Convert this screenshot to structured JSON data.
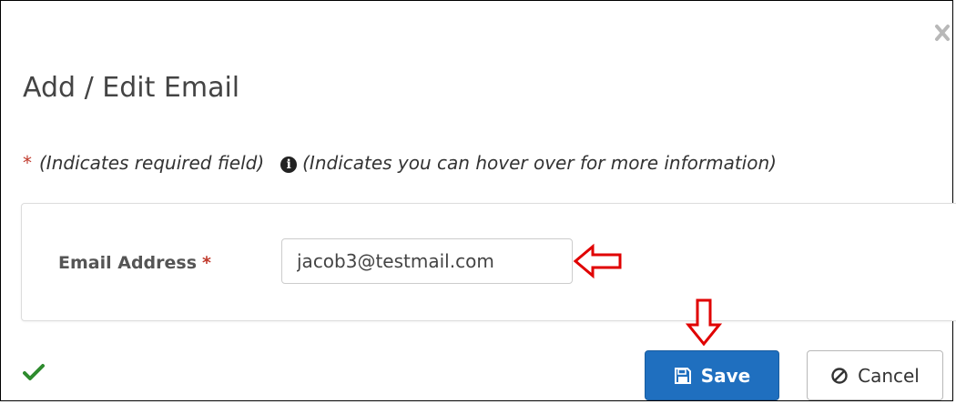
{
  "modal": {
    "title": "Add / Edit Email",
    "close_icon": "close-icon"
  },
  "legend": {
    "required_marker": "*",
    "required_text": "(Indicates required field)",
    "info_icon": "info-circle-icon",
    "info_text": "(Indicates you can hover over for more information)"
  },
  "form": {
    "email_label": "Email Address",
    "email_required_marker": "*",
    "email_value": "jacob3@testmail.com"
  },
  "footer": {
    "status_icon": "checkmark-icon",
    "save_label": "Save",
    "save_icon": "floppy-disk-icon",
    "cancel_label": "Cancel",
    "cancel_icon": "ban-icon"
  },
  "annotations": {
    "arrow_color": "#e00000"
  },
  "colors": {
    "primary": "#1f6fbf",
    "required": "#c0392b",
    "success": "#2e8b2e"
  }
}
